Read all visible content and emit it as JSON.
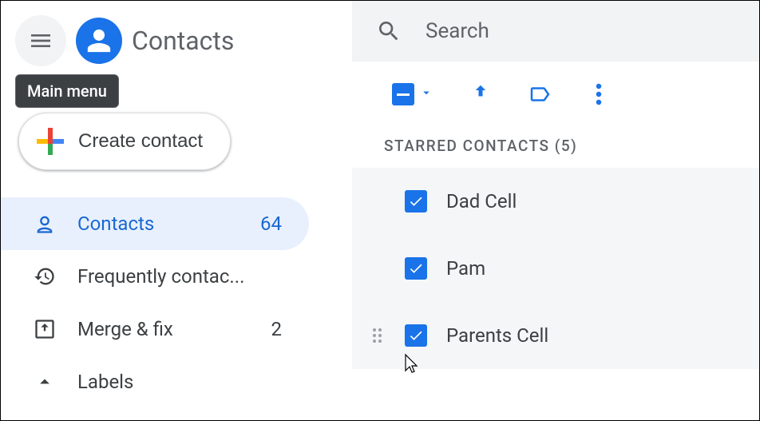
{
  "header": {
    "app_title": "Contacts",
    "tooltip": "Main menu"
  },
  "create_button": {
    "label": "Create contact"
  },
  "sidebar": {
    "items": [
      {
        "label": "Contacts",
        "count": "64",
        "active": true
      },
      {
        "label": "Frequently contac...",
        "count": "",
        "active": false
      },
      {
        "label": "Merge & fix",
        "count": "2",
        "active": false
      }
    ],
    "labels_header": "Labels"
  },
  "search": {
    "placeholder": "Search"
  },
  "section": {
    "starred_header": "STARRED CONTACTS (5)"
  },
  "contacts": [
    {
      "name": "Dad Cell",
      "checked": true
    },
    {
      "name": "Pam",
      "checked": true
    },
    {
      "name": "Parents Cell",
      "checked": true
    }
  ],
  "colors": {
    "primary": "#1a73e8"
  }
}
